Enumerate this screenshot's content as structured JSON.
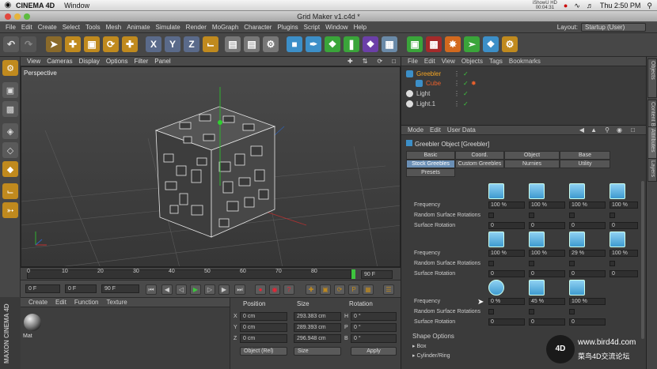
{
  "mac_menubar": {
    "apple": "",
    "app_name": "CINEMA 4D",
    "items": [
      "Window"
    ],
    "status_line1": "iShowU HD",
    "status_line2": "00:04:31",
    "clock": "Thu 2:50 PM"
  },
  "window": {
    "title": "Grid Maker v1.c4d *"
  },
  "menubar": {
    "items": [
      "File",
      "Edit",
      "Create",
      "Select",
      "Tools",
      "Mesh",
      "Animate",
      "Simulate",
      "Render",
      "MoGraph",
      "Character",
      "Plugins",
      "Script",
      "Window",
      "Help"
    ],
    "layout_label": "Layout:",
    "layout_value": "Startup (User)"
  },
  "viewport": {
    "menu": [
      "View",
      "Cameras",
      "Display",
      "Options",
      "Filter",
      "Panel"
    ],
    "label": "Perspective"
  },
  "timeline": {
    "ticks": [
      "0",
      "10",
      "20",
      "30",
      "40",
      "50",
      "60",
      "70",
      "80",
      "90"
    ],
    "end_frame": "90 F"
  },
  "transport": {
    "current_frame": "0 F",
    "start_frame": "0 F",
    "end_frame": "90 F",
    "max_frame": "90 F"
  },
  "material_manager": {
    "menu": [
      "Create",
      "Edit",
      "Function",
      "Texture"
    ],
    "material_name": "Mat",
    "brand": "MAXON CINEMA 4D"
  },
  "coordinates": {
    "headers": {
      "position": "Position",
      "size": "Size",
      "rotation": "Rotation"
    },
    "rows": [
      {
        "axis": "X",
        "pos": "0 cm",
        "size": "293.383 cm",
        "rot_axis": "H",
        "rot": "0 °"
      },
      {
        "axis": "Y",
        "pos": "0 cm",
        "size": "289.393 cm",
        "rot_axis": "P",
        "rot": "0 °"
      },
      {
        "axis": "Z",
        "pos": "0 cm",
        "size": "296.948 cm",
        "rot_axis": "B",
        "rot": "0 °"
      }
    ],
    "mode": "Object (Rel)",
    "size_mode": "Size",
    "apply": "Apply"
  },
  "object_manager": {
    "menu": [
      "File",
      "Edit",
      "View",
      "Objects",
      "Tags",
      "Bookmarks"
    ],
    "objects": [
      {
        "name": "Greebler",
        "color": "#f5a623"
      },
      {
        "name": "Cube",
        "color": "#e8602c"
      },
      {
        "name": "Light",
        "color": "#dddddd"
      },
      {
        "name": "Light.1",
        "color": "#dddddd"
      }
    ]
  },
  "attributes": {
    "menu": [
      "Mode",
      "Edit",
      "User Data"
    ],
    "title": "Greebler Object [Greebler]",
    "tabs_row1": [
      "Basic",
      "Coord.",
      "Object",
      "Base"
    ],
    "tabs_row2": [
      "Stock Greebles",
      "Custom Greebles",
      "Nurnies",
      "Utility"
    ],
    "tabs_row3": [
      "Presets"
    ],
    "active_tab": "Stock Greebles",
    "groups": [
      {
        "freq_label": "Frequency",
        "rot_label": "Random Surface Rotations",
        "surf_label": "Surface Rotation",
        "freq": [
          "100 %",
          "100 %",
          "100 %",
          "100 %"
        ],
        "surf": [
          "0",
          "0",
          "0",
          "0"
        ]
      },
      {
        "freq_label": "Frequency",
        "rot_label": "Random Surface Rotations",
        "surf_label": "Surface Rotation",
        "freq": [
          "100 %",
          "100 %",
          "29 %",
          "100 %"
        ],
        "surf": [
          "0",
          "0",
          "0",
          "0"
        ]
      },
      {
        "freq_label": "Frequency",
        "rot_label": "Random Surface Rotations",
        "surf_label": "Surface Rotation",
        "freq": [
          "0 %",
          "45 %",
          "100 %"
        ],
        "surf": [
          "0",
          "0",
          "0"
        ]
      }
    ],
    "shape_options": "Shape Options",
    "sub_items": [
      "Box",
      "Cylinder/Ring"
    ]
  },
  "side_tabs": [
    "Objects",
    "Content B.",
    "Attributes",
    "Layers"
  ],
  "watermark": {
    "logo": "4D",
    "url": "www.bird4d.com",
    "cn": "菜鸟4D交流论坛"
  },
  "colors": {
    "accent": "#6b8fb5",
    "panel": "#3b3b3b",
    "greeble_shape": "#5bb3e2"
  }
}
